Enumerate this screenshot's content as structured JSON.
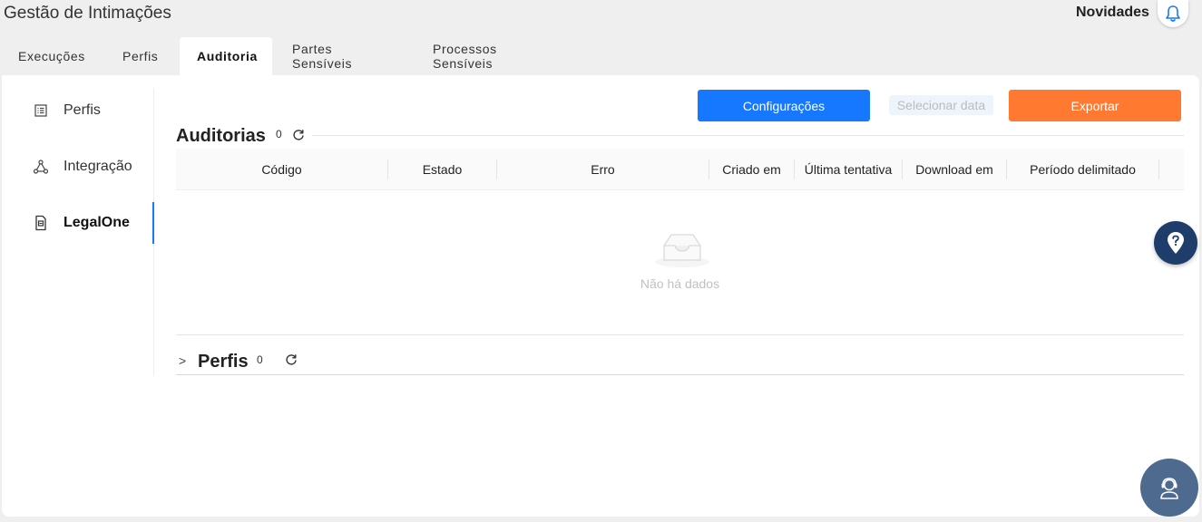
{
  "header": {
    "app_title": "Gestão de Intimações",
    "news_label": "Novidades"
  },
  "tabs": [
    {
      "label": "Execuções"
    },
    {
      "label": "Perfis"
    },
    {
      "label": "Auditoria",
      "active": true
    },
    {
      "label": "Partes Sensíveis"
    },
    {
      "label": "Processos Sensíveis"
    }
  ],
  "sidebar": {
    "items": [
      {
        "label": "Perfis",
        "icon": "list-icon"
      },
      {
        "label": "Integração",
        "icon": "network-icon"
      },
      {
        "label": "LegalOne",
        "icon": "document-icon",
        "active": true
      }
    ]
  },
  "toolbar": {
    "config_label": "Configurações",
    "date_placeholder": "Selecionar data",
    "export_label": "Exportar"
  },
  "auditorias": {
    "title": "Auditorias",
    "count": "0",
    "columns": [
      "Código",
      "Estado",
      "Erro",
      "Criado em",
      "Última tentativa",
      "Download em",
      "Período delimitado"
    ],
    "empty_text": "Não há dados"
  },
  "perfis": {
    "title": "Perfis",
    "count": "0"
  },
  "colors": {
    "primary": "#1677ff",
    "export": "#ff7a30",
    "help": "#1f3d6b",
    "support": "#4e6a8f"
  }
}
